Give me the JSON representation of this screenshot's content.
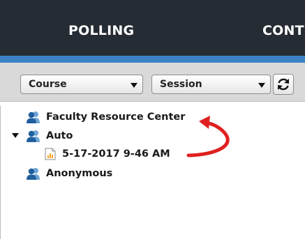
{
  "header": {
    "tabs": [
      {
        "label": "POLLING"
      },
      {
        "label": "CONT"
      }
    ]
  },
  "toolbar": {
    "course_select": {
      "value": "Course"
    },
    "session_select": {
      "value": "Session"
    },
    "refresh_icon": "refresh-icon"
  },
  "tree": {
    "items": [
      {
        "label": "Faculty Resource Center",
        "icon": "user-group-icon"
      },
      {
        "label": "Auto",
        "icon": "user-group-icon",
        "expanded": true,
        "children": [
          {
            "label": "5-17-2017 9-46 AM",
            "icon": "session-document-icon"
          }
        ]
      },
      {
        "label": "Anonymous",
        "icon": "user-group-icon"
      }
    ]
  },
  "colors": {
    "header_bg": "#262c33",
    "accent": "#3b82c4",
    "toolbar_bg": "#d9d9d9",
    "annotation_arrow": "#e02020"
  }
}
